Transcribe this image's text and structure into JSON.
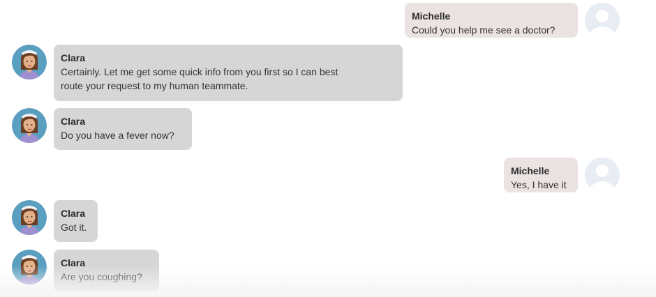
{
  "messages": [
    {
      "sender": "Michelle",
      "text": "Could you help me see a doctor?",
      "avatar": "user-placeholder-icon"
    },
    {
      "sender": "Clara",
      "text_lines": [
        "Certainly. Let me get some quick info from you first so I can best",
        "route your request to my human teammate."
      ],
      "avatar": "nurse-avatar"
    },
    {
      "sender": "Clara",
      "text": "Do you have a fever now?",
      "avatar": "nurse-avatar"
    },
    {
      "sender": "Michelle",
      "text": "Yes, I have it",
      "avatar": "user-placeholder-icon"
    },
    {
      "sender": "Clara",
      "text": "Got it.",
      "avatar": "nurse-avatar"
    },
    {
      "sender": "Clara",
      "text": "Are you coughing?",
      "avatar": "nurse-avatar"
    }
  ],
  "colors": {
    "bot_bubble": "#d6d6d6",
    "user_bubble": "#ebe2e2",
    "avatar_bg": "#5a9ec0",
    "user_avatar_bg": "#e8ecf3"
  }
}
